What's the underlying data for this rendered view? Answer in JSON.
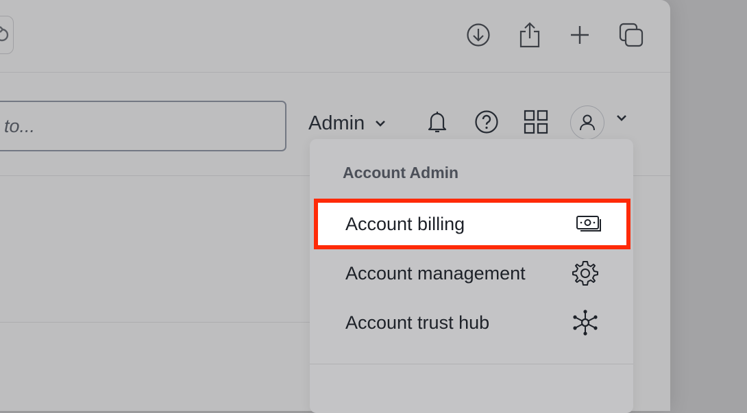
{
  "search": {
    "placeholder": "to..."
  },
  "header": {
    "admin_label": "Admin"
  },
  "dropdown": {
    "heading": "Account Admin",
    "items": [
      {
        "label": "Account billing",
        "icon": "billing-icon",
        "highlighted": true
      },
      {
        "label": "Account management",
        "icon": "gear-icon"
      },
      {
        "label": "Account trust hub",
        "icon": "trust-hub-icon"
      }
    ]
  },
  "colors": {
    "highlight_border": "#ff2a08",
    "text": "#1d2128"
  }
}
